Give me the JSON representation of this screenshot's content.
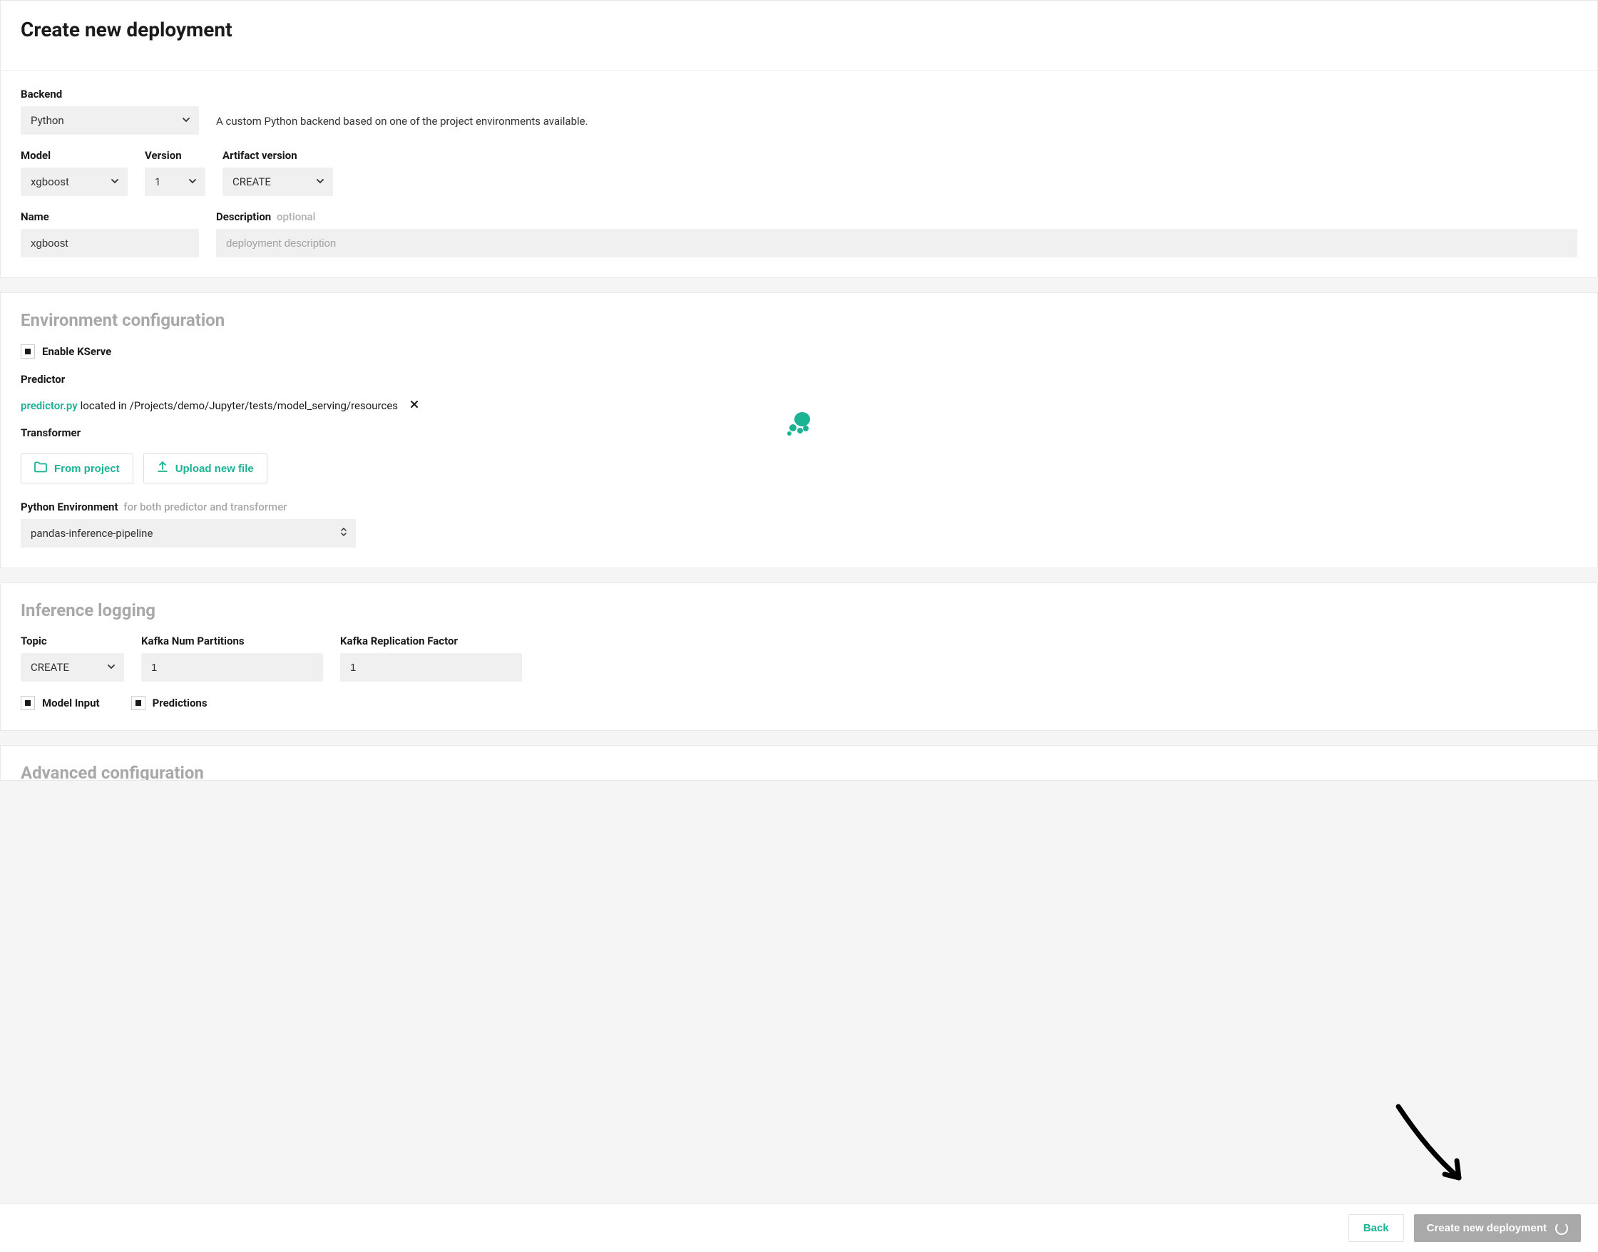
{
  "page": {
    "title": "Create new deployment"
  },
  "backend": {
    "label": "Backend",
    "value": "Python",
    "helper": "A custom Python backend based on one of the project environments available."
  },
  "model": {
    "label": "Model",
    "value": "xgboost"
  },
  "version": {
    "label": "Version",
    "value": "1"
  },
  "artifact": {
    "label": "Artifact version",
    "value": "CREATE"
  },
  "name": {
    "label": "Name",
    "value": "xgboost"
  },
  "description": {
    "label": "Description",
    "optional": "optional",
    "placeholder": "deployment description"
  },
  "envconfig": {
    "title": "Environment configuration",
    "kserve": {
      "label": "Enable KServe"
    },
    "predictor": {
      "label": "Predictor",
      "filename": "predictor.py",
      "path": "located in /Projects/demo/Jupyter/tests/model_serving/resources"
    },
    "transformer": {
      "label": "Transformer",
      "from_project": "From project",
      "upload": "Upload new file"
    },
    "python_env": {
      "label": "Python Environment",
      "hint": "for both predictor and transformer",
      "value": "pandas-inference-pipeline"
    }
  },
  "inference": {
    "title": "Inference logging",
    "topic": {
      "label": "Topic",
      "value": "CREATE"
    },
    "partitions": {
      "label": "Kafka Num Partitions",
      "value": "1"
    },
    "replication": {
      "label": "Kafka Replication Factor",
      "value": "1"
    },
    "model_input": {
      "label": "Model Input"
    },
    "predictions": {
      "label": "Predictions"
    }
  },
  "advanced": {
    "title": "Advanced configuration"
  },
  "footer": {
    "back": "Back",
    "create": "Create new deployment"
  }
}
